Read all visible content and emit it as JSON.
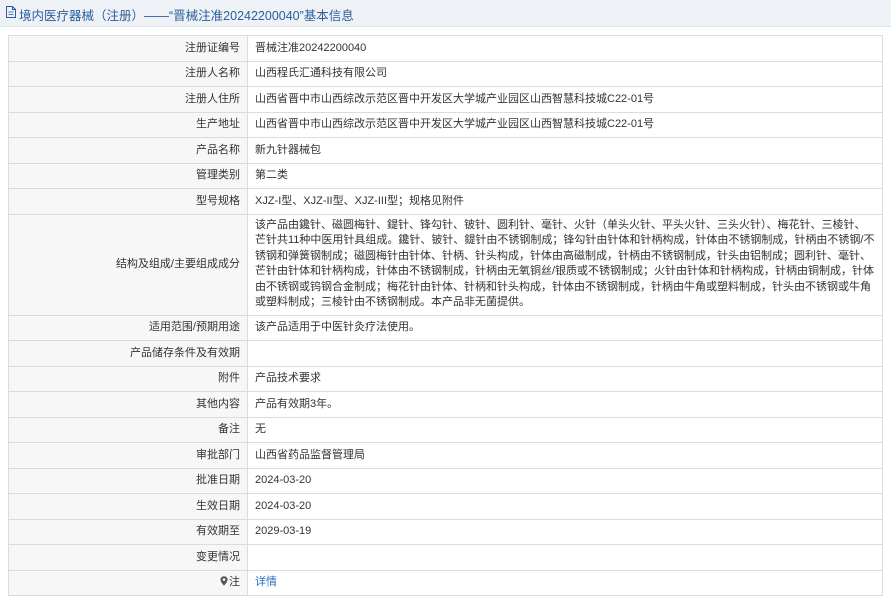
{
  "header": {
    "title": "境内医疗器械（注册）——“晋械注准20242200040”基本信息"
  },
  "rows": [
    {
      "label": "注册证编号",
      "value": "晋械注准20242200040"
    },
    {
      "label": "注册人名称",
      "value": "山西程氏汇通科技有限公司"
    },
    {
      "label": "注册人住所",
      "value": "山西省晋中市山西综改示范区晋中开发区大学城产业园区山西智慧科技城C22-01号"
    },
    {
      "label": "生产地址",
      "value": "山西省晋中市山西综改示范区晋中开发区大学城产业园区山西智慧科技城C22-01号"
    },
    {
      "label": "产品名称",
      "value": "新九针器械包"
    },
    {
      "label": "管理类别",
      "value": "第二类"
    },
    {
      "label": "型号规格",
      "value": "XJZ-I型、XJZ-II型、XJZ-III型；规格见附件"
    },
    {
      "label": "结构及组成/主要组成成分",
      "value": "该产品由鑱针、磁圆梅针、鍉针、锋勾针、铍针、圆利针、毫针、火针（单头火针、平头火针、三头火针）、梅花针、三棱针、芒针共11种中医用针具组成。鑱针、铍针、鍉针由不锈钢制成；锋勾针由针体和针柄构成，针体由不锈钢制成，针柄由不锈钢/不锈钢和弹簧钢制成；磁圆梅针由针体、针柄、针头构成，针体由高磁制成，针柄由不锈钢制成，针头由铝制成；圆利针、毫针、芒针由针体和针柄构成，针体由不锈钢制成，针柄由无氧铜丝/银质或不锈钢制成；火针由针体和针柄构成，针柄由铜制成，针体由不锈钢或钨钢合金制成；梅花针由针体、针柄和针头构成，针体由不锈钢制成，针柄由牛角或塑料制成，针头由不锈钢或牛角或塑料制成；三棱针由不锈钢制成。本产品非无菌提供。"
    },
    {
      "label": "适用范围/预期用途",
      "value": "该产品适用于中医针灸疗法使用。"
    },
    {
      "label": "产品储存条件及有效期",
      "value": ""
    },
    {
      "label": "附件",
      "value": "产品技术要求"
    },
    {
      "label": "其他内容",
      "value": "产品有效期3年。"
    },
    {
      "label": "备注",
      "value": "无"
    },
    {
      "label": "审批部门",
      "value": "山西省药品监督管理局"
    },
    {
      "label": "批准日期",
      "value": "2024-03-20"
    },
    {
      "label": "生效日期",
      "value": "2024-03-20"
    },
    {
      "label": "有效期至",
      "value": "2029-03-19"
    },
    {
      "label": "变更情况",
      "value": ""
    }
  ],
  "note_row": {
    "label": "注",
    "link_text": "详情"
  },
  "colors": {
    "title": "#2a5d9a",
    "link": "#2a6fc4",
    "label_bg": "#f7f7f7",
    "border": "#dcdcdc"
  },
  "icons": {
    "title_icon": "document-icon",
    "note_icon": "map-pin-icon"
  }
}
